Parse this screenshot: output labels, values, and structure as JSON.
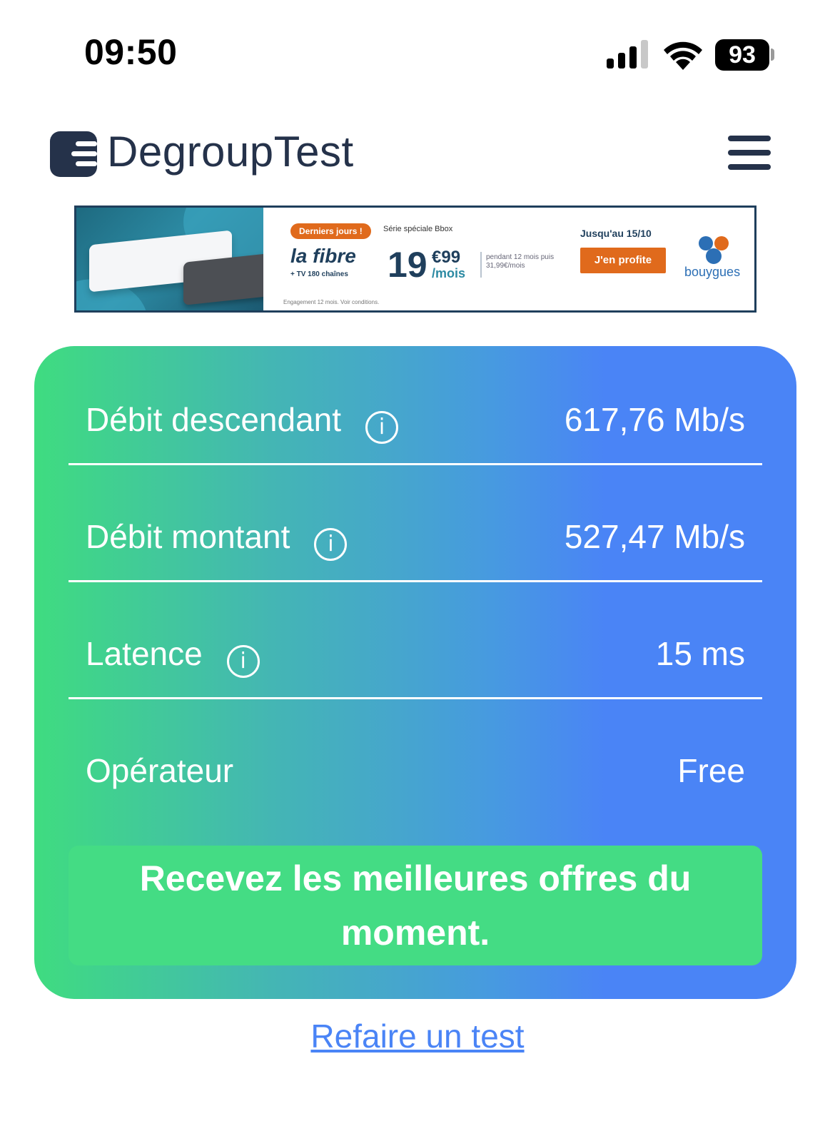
{
  "status_bar": {
    "time": "09:50",
    "battery": "93",
    "icons": [
      "signal-icon",
      "wifi-icon",
      "battery-icon"
    ]
  },
  "header": {
    "brand": "DegroupTest",
    "icons": [
      "logo-icon",
      "hamburger-menu-icon"
    ]
  },
  "ad": {
    "badge": "Derniers jours !",
    "badge_note": "Série spéciale Bbox",
    "product": "la fibre",
    "product_sub": "+ TV 180 chaînes",
    "price_whole": "19",
    "price_cents": "€99",
    "price_period": "/mois",
    "fineprint": "pendant 12 mois puis 31,99€/mois",
    "until": "Jusqu'au 15/10",
    "cta": "J'en profite",
    "brand": "bouygues",
    "bottom_note": "Engagement 12 mois. Voir conditions."
  },
  "results": {
    "rows": [
      {
        "label": "Débit descendant",
        "value": "617,76 Mb/s",
        "has_info": true
      },
      {
        "label": "Débit montant",
        "value": "527,47 Mb/s",
        "has_info": true
      },
      {
        "label": "Latence",
        "value": "15 ms",
        "has_info": true
      },
      {
        "label": "Opérateur",
        "value": "Free",
        "has_info": false
      }
    ],
    "info_glyph": "i",
    "offers_button": "Recevez les meilleures offres du moment."
  },
  "retest_link": "Refaire un test",
  "colors": {
    "brand_dark": "#25324a",
    "card_green": "#3fdc80",
    "card_blue": "#4a84f6",
    "button_green": "#44dc84",
    "link_blue": "#4a84f6",
    "ad_orange": "#e06a1c"
  }
}
